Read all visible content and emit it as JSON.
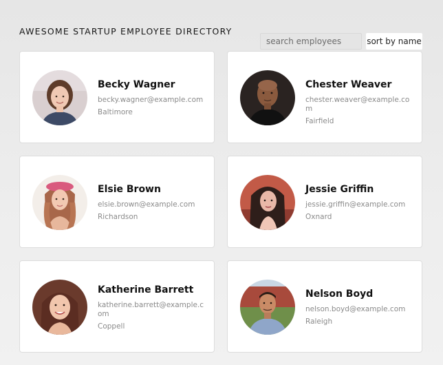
{
  "header": {
    "title": "AWESOME STARTUP EMPLOYEE DIRECTORY"
  },
  "controls": {
    "search_placeholder": "search employees",
    "search_value": "",
    "sort_label": "sort by name"
  },
  "employees": [
    {
      "name": "Becky Wagner",
      "email": "becky.wagner@example.com",
      "city": "Baltimore"
    },
    {
      "name": "Chester Weaver",
      "email": "chester.weaver@example.com",
      "city": "Fairfield"
    },
    {
      "name": "Elsie Brown",
      "email": "elsie.brown@example.com",
      "city": "Richardson"
    },
    {
      "name": "Jessie Griffin",
      "email": "jessie.griffin@example.com",
      "city": "Oxnard"
    },
    {
      "name": "Katherine Barrett",
      "email": "katherine.barrett@example.com",
      "city": "Coppell"
    },
    {
      "name": "Nelson Boyd",
      "email": "nelson.boyd@example.com",
      "city": "Raleigh"
    }
  ]
}
